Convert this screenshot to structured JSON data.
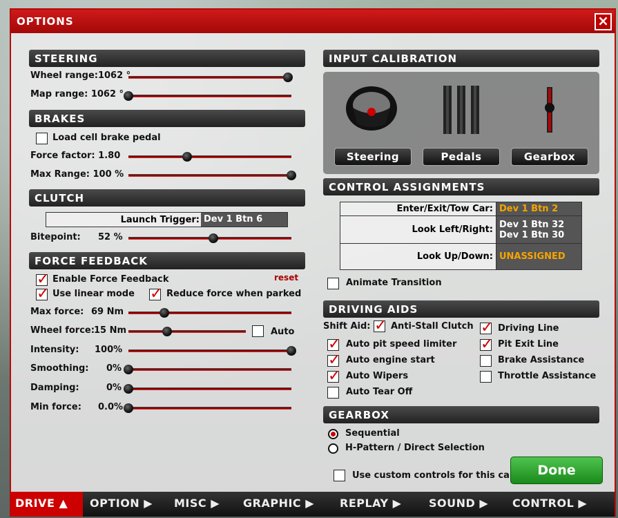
{
  "window": {
    "title": "OPTIONS",
    "close_icon": "×"
  },
  "steering": {
    "header": "STEERING",
    "wheel_range_label": "Wheel range:1062 °",
    "map_range_label": "Map range:   1062 °"
  },
  "brakes": {
    "header": "BRAKES",
    "load_cell_label": "Load cell brake pedal",
    "force_factor_label": "Force factor:   1.80",
    "max_range_label": "Max Range:   100 %"
  },
  "clutch": {
    "header": "CLUTCH",
    "launch_trigger_label": "Launch Trigger:",
    "launch_trigger_value": "Dev 1 Btn 6",
    "bitepoint_label": "Bitepoint:",
    "bitepoint_value": "52 %"
  },
  "ffb": {
    "header": "FORCE FEEDBACK",
    "reset": "reset",
    "enable_label": "Enable Force Feedback",
    "linear_label": "Use linear mode",
    "reduce_label": "Reduce force when parked",
    "max_force_label": "Max force:",
    "max_force_value": "69 Nm",
    "wheel_force_label": "Wheel force:",
    "wheel_force_value": "15 Nm",
    "auto_label": "Auto",
    "intensity_label": "Intensity:",
    "intensity_value": "100%",
    "smoothing_label": "Smoothing:",
    "smoothing_value": "0%",
    "damping_label": "Damping:",
    "damping_value": "0%",
    "min_force_label": "Min force:",
    "min_force_value": "0.0%"
  },
  "sliders": {
    "wheel_range": 0.98,
    "map_range": 0.0,
    "force_factor": 0.36,
    "max_range": 1.0,
    "bitepoint": 0.52,
    "max_force": 0.22,
    "wheel_force": 0.33,
    "intensity": 1.0,
    "smoothing": 0.0,
    "damping": 0.0,
    "min_force": 0.0
  },
  "calibration": {
    "header": "INPUT CALIBRATION",
    "steering_label": "Steering",
    "pedals_label": "Pedals",
    "gearbox_label": "Gearbox"
  },
  "assignments": {
    "header": "CONTROL ASSIGNMENTS",
    "rows": [
      {
        "key": "Enter/Exit/Tow Car:",
        "value": "Dev 1 Btn 2"
      },
      {
        "key": "Look Left/Right:",
        "value1": "Dev 1 Btn 32",
        "value2": "Dev 1 Btn 30"
      },
      {
        "key": "Look Up/Down:",
        "value": "UNASSIGNED"
      }
    ],
    "animate_label": "Animate Transition"
  },
  "aids": {
    "header": "DRIVING AIDS",
    "shift_aid_label": "Shift Aid:",
    "anti_stall": "Anti-Stall Clutch",
    "driving_line": "Driving Line",
    "pit_limiter": "Auto pit speed limiter",
    "pit_exit": "Pit Exit Line",
    "engine_start": "Auto engine start",
    "brake_assist": "Brake Assistance",
    "wipers": "Auto Wipers",
    "throttle_assist": "Throttle Assistance",
    "tear_off": "Auto Tear Off"
  },
  "gearbox": {
    "header": "GEARBOX",
    "sequential": "Sequential",
    "hpattern": "H-Pattern / Direct Selection",
    "custom_controls": "Use custom controls for this car"
  },
  "done_label": "Done",
  "tabs": [
    "DRIVE ▲",
    "OPTION ▶",
    "MISC ▶",
    "GRAPHIC ▶",
    "REPLAY ▶",
    "SOUND ▶",
    "CONTROL ▶"
  ],
  "colors": {
    "accent": "#c00000",
    "assigned": "#f6a400",
    "done": "#2ea82e"
  }
}
